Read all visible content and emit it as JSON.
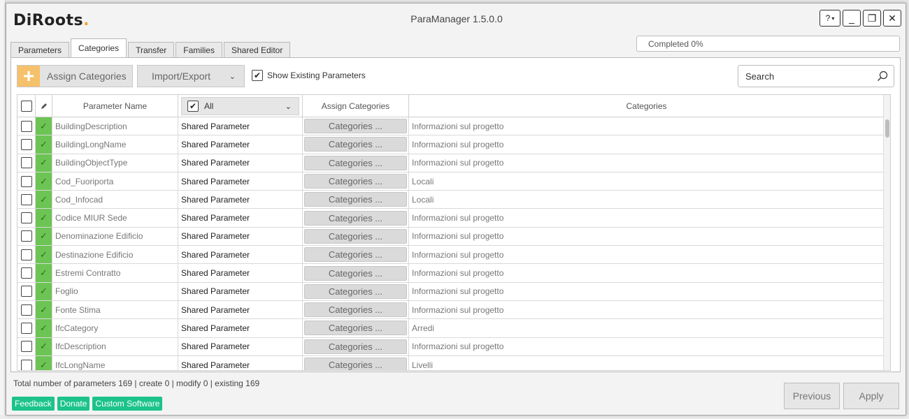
{
  "window": {
    "logo": "DiRoots",
    "title": "ParaManager 1.5.0.0",
    "help_label": "?",
    "minimize_label": "_",
    "restore_label": "❐",
    "close_label": "✕"
  },
  "progress": {
    "text": "Completed 0%",
    "value_percent": 0
  },
  "tabs": [
    {
      "label": "Parameters",
      "active": false
    },
    {
      "label": "Categories",
      "active": true
    },
    {
      "label": "Transfer",
      "active": false
    },
    {
      "label": "Families",
      "active": false
    },
    {
      "label": "Shared Editor",
      "active": false
    }
  ],
  "toolbar": {
    "assign_label": "Assign Categories",
    "import_export_label": "Import/Export",
    "show_existing_label": "Show Existing Parameters",
    "show_existing_checked": true,
    "search_placeholder": "Search"
  },
  "table": {
    "headers": {
      "name": "Parameter Name",
      "type_filter": "All",
      "assign": "Assign Categories",
      "categories": "Categories"
    },
    "button_label": "Categories ...",
    "rows": [
      {
        "name": "BuildingDescription",
        "type": "Shared Parameter",
        "categories": "Informazioni sul progetto"
      },
      {
        "name": "BuildingLongName",
        "type": "Shared Parameter",
        "categories": "Informazioni sul progetto"
      },
      {
        "name": "BuildingObjectType",
        "type": "Shared Parameter",
        "categories": "Informazioni sul progetto"
      },
      {
        "name": "Cod_Fuoriporta",
        "type": "Shared Parameter",
        "categories": "Locali"
      },
      {
        "name": "Cod_Infocad",
        "type": "Shared Parameter",
        "categories": "Locali"
      },
      {
        "name": "Codice MIUR Sede",
        "type": "Shared Parameter",
        "categories": "Informazioni sul progetto"
      },
      {
        "name": "Denominazione Edificio",
        "type": "Shared Parameter",
        "categories": "Informazioni sul progetto"
      },
      {
        "name": "Destinazione Edificio",
        "type": "Shared Parameter",
        "categories": "Informazioni sul progetto"
      },
      {
        "name": "Estremi Contratto",
        "type": "Shared Parameter",
        "categories": "Informazioni sul progetto"
      },
      {
        "name": "Foglio",
        "type": "Shared Parameter",
        "categories": "Informazioni sul progetto"
      },
      {
        "name": "Fonte Stima",
        "type": "Shared Parameter",
        "categories": "Informazioni sul progetto"
      },
      {
        "name": "IfcCategory",
        "type": "Shared Parameter",
        "categories": "Arredi"
      },
      {
        "name": "IfcDescription",
        "type": "Shared Parameter",
        "categories": "Informazioni sul progetto"
      },
      {
        "name": "IfcLongName",
        "type": "Shared Parameter",
        "categories": "Livelli"
      }
    ]
  },
  "footer": {
    "totals": "Total number of parameters 169 | create 0 | modify 0 | existing 169",
    "links": [
      "Feedback",
      "Donate",
      "Custom Software"
    ],
    "previous_label": "Previous",
    "apply_label": "Apply"
  },
  "colors": {
    "accent_orange": "#f5c16b",
    "edit_green": "#6cc454",
    "link_green": "#1cc38a"
  }
}
